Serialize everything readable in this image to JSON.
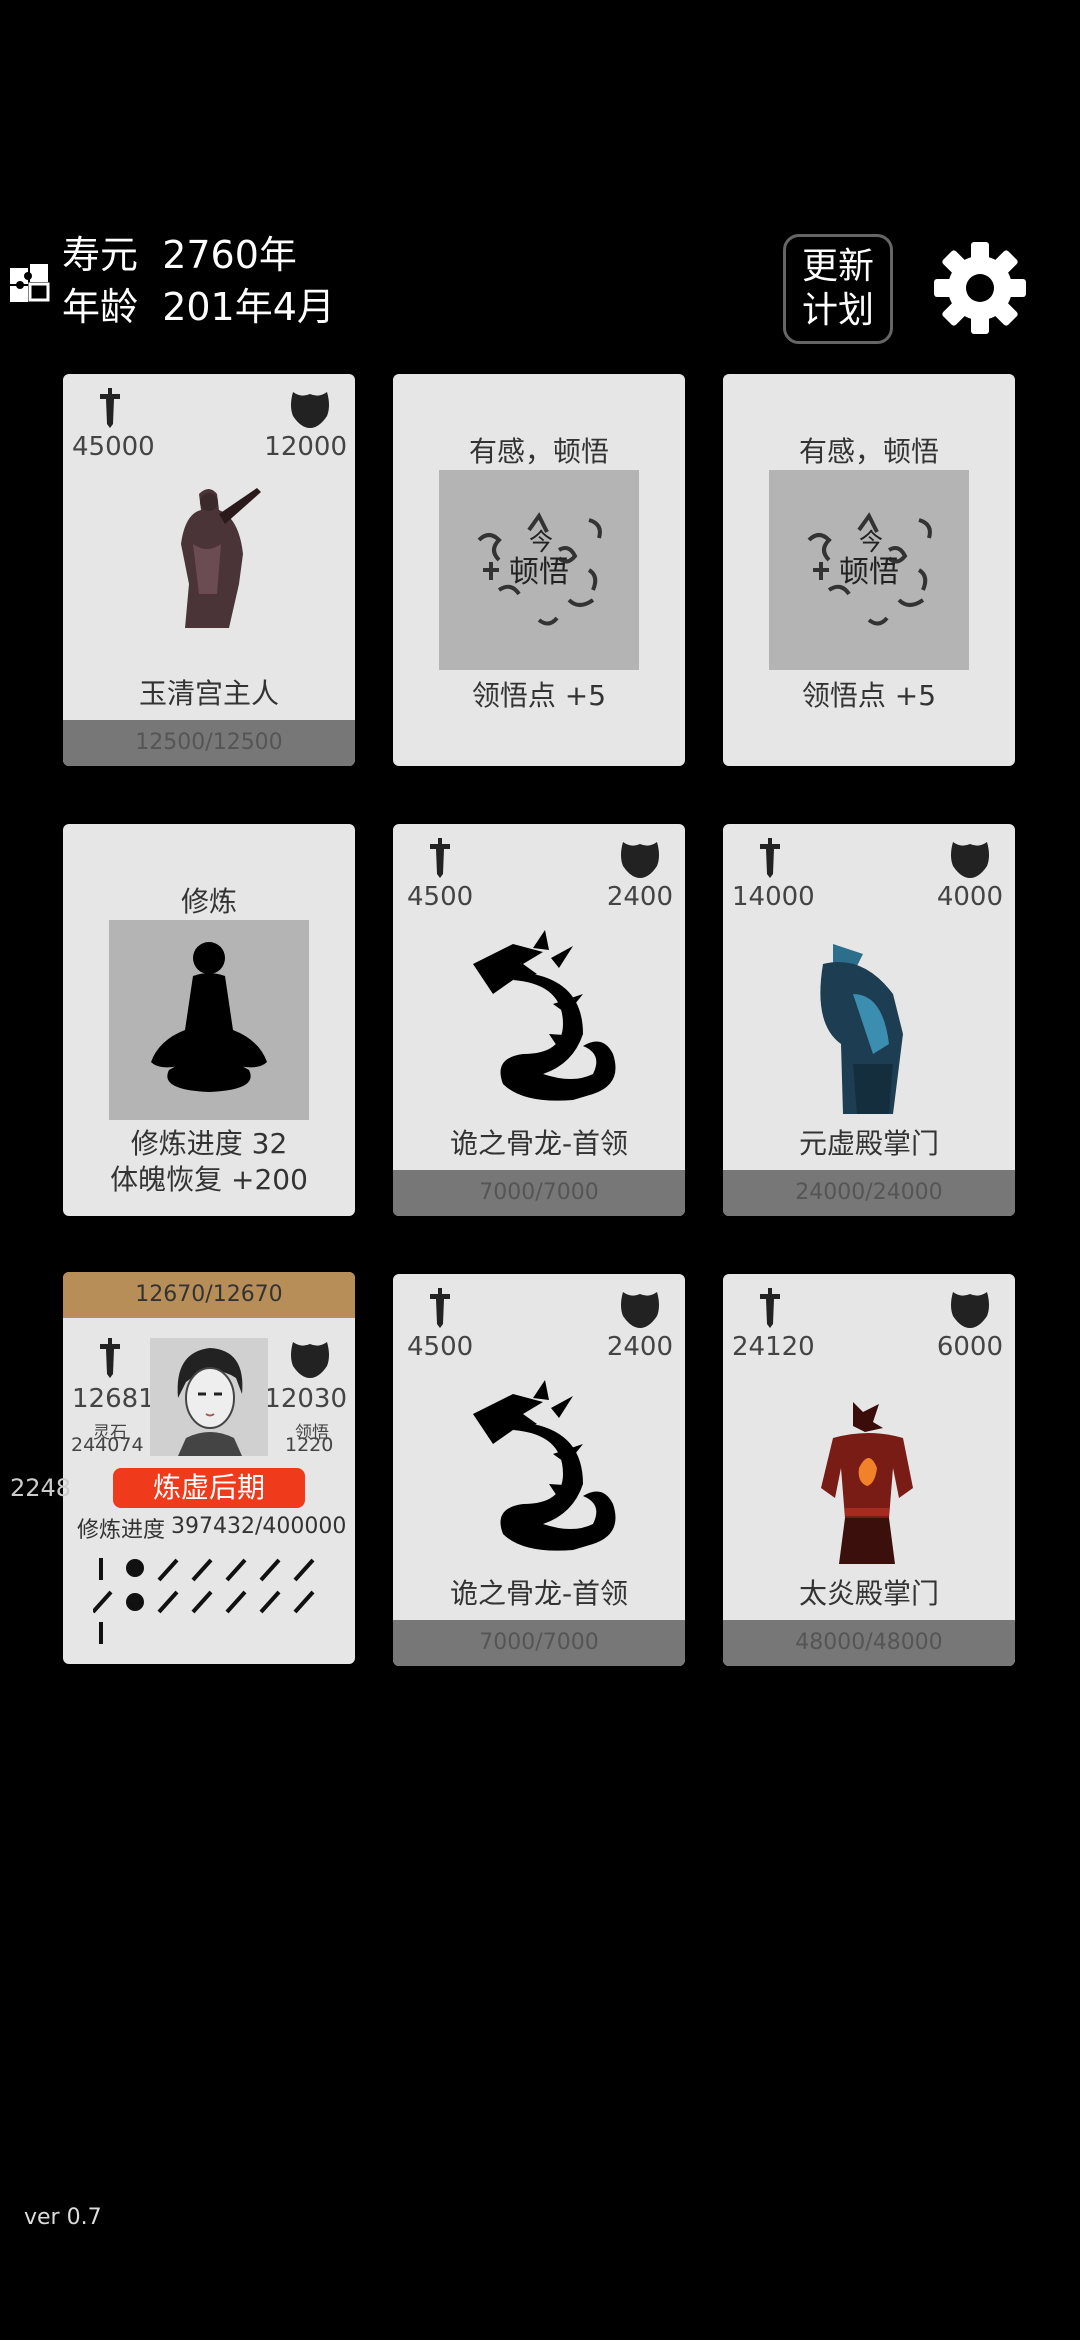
{
  "header": {
    "lifespan_label": "寿元",
    "lifespan_value": "2760年",
    "age_label": "年龄",
    "age_value": "201年4月",
    "plan_button": "更新\n计划"
  },
  "cards": [
    {
      "type": "enemy",
      "name": "玉清宫主人",
      "attack": "45000",
      "defense": "12000",
      "hp": "12500/12500"
    },
    {
      "type": "insight",
      "title": "有感，顿悟",
      "effect": "领悟点 +5"
    },
    {
      "type": "insight",
      "title": "有感，顿悟",
      "effect": "领悟点 +5"
    },
    {
      "type": "cultivate",
      "title": "修炼",
      "line1": "修炼进度  32",
      "line2": "体魄恢复  +200"
    },
    {
      "type": "enemy",
      "name": "诡之骨龙-首领",
      "attack": "4500",
      "defense": "2400",
      "hp": "7000/7000"
    },
    {
      "type": "enemy",
      "name": "元虚殿掌门",
      "attack": "14000",
      "defense": "4000",
      "hp": "24000/24000"
    },
    {
      "type": "player",
      "hp": "12670/12670",
      "attack": "12681",
      "defense": "12030",
      "stone_label": "灵石",
      "stone_value": "244074",
      "insight_label": "领悟",
      "insight_value": "1220",
      "realm": "炼虚后期",
      "progress_label": "修炼进度",
      "progress_value": "397432/400000"
    },
    {
      "type": "enemy",
      "name": "诡之骨龙-首领",
      "attack": "4500",
      "defense": "2400",
      "hp": "7000/7000"
    },
    {
      "type": "enemy",
      "name": "太炎殿掌门",
      "attack": "24120",
      "defense": "6000",
      "hp": "48000/48000"
    }
  ],
  "side_number": "2248",
  "version": "ver 0.7",
  "colors": {
    "card_bg": "#e6e6e6",
    "hp_bar": "#777777",
    "player_hp_bar": "#b88e58",
    "realm_badge": "#ef3b1b"
  }
}
